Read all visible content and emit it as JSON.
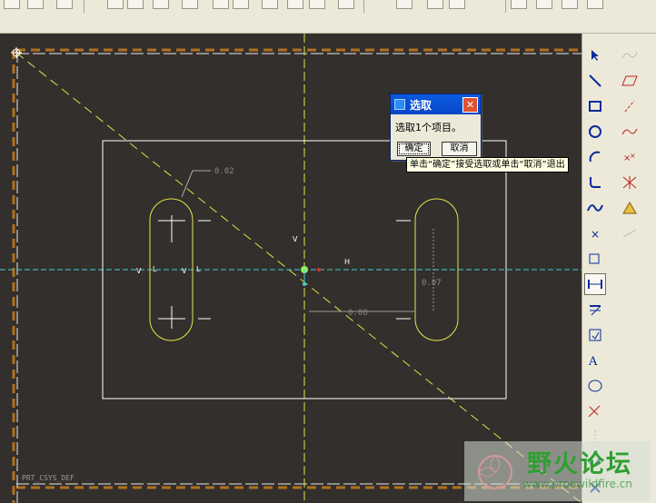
{
  "dialog": {
    "title": "选取",
    "close_glyph": "✕",
    "message": "选取1个项目。",
    "ok_label": "确定",
    "cancel_label": "取消"
  },
  "tooltip": "单击“确定”接受选取或单击“取消”退出",
  "sketch": {
    "dim_top": "0.02",
    "dim_vertical": "0.07",
    "dim_horizontal": "0.08",
    "label_v": "V",
    "label_h": "H",
    "label_l": "L",
    "csys_label": "PRT_CSYS_DEF"
  },
  "watermark": {
    "site_name": "野火论坛",
    "url": "www.proewildfire.cn"
  },
  "right_toolbar": {
    "tools": [
      "select-arrow",
      "line",
      "rectangle",
      "circle",
      "arc",
      "fillet",
      "spline",
      "point",
      "offset-edge",
      "dimension",
      "modify",
      "constraints",
      "text",
      "palette",
      "trim",
      "mirror",
      "accept",
      "cancel"
    ]
  },
  "colors": {
    "canvas_bg": "#332f2c",
    "sketch_white": "#ffffff",
    "sketch_yellow": "#e5e54c",
    "centerline_yellow": "#e0e04a",
    "axis_cyan": "#3fd0d8",
    "frame_orange": "#b07020"
  }
}
